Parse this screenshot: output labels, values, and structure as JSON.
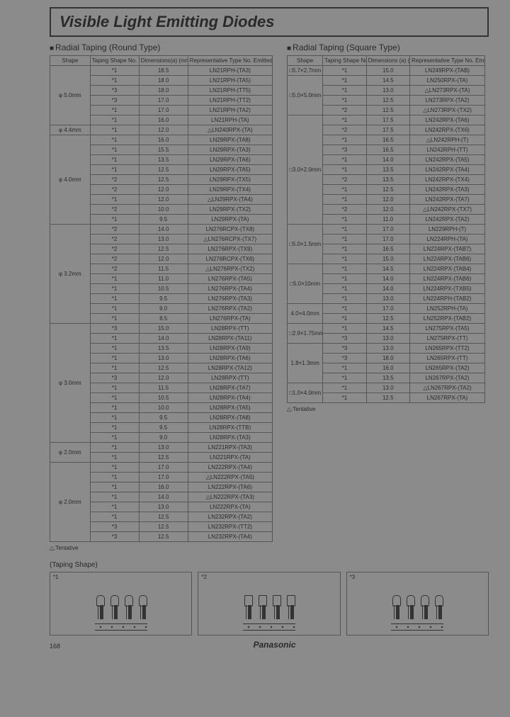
{
  "page_number": "168",
  "brand": "Panasonic",
  "title": "Visible Light Emitting Diodes",
  "tentative_note": "△:Tentative",
  "taping_shape_label": "(Taping Shape)",
  "diagram_labels": [
    "*1",
    "*2",
    "*3"
  ],
  "round": {
    "heading": "Radial Taping (Round Type)",
    "headers": [
      "Shape",
      "Taping Shape No.",
      "Dimensions(a) (mm)",
      "Representative Type No. Emitted Color (Red)"
    ],
    "groups": [
      {
        "shape": "φ 5.0mm",
        "rows": [
          {
            "ts": "*1",
            "dim": "18.5",
            "rep": "LN21RPH-(TA3)"
          },
          {
            "ts": "*1",
            "dim": "18.0",
            "rep": "LN21RPH-(TA5)"
          },
          {
            "ts": "*3",
            "dim": "18.0",
            "rep": "LN21RPH-(TT5)"
          },
          {
            "ts": "*3",
            "dim": "17.0",
            "rep": "LN21RPH-(TT2)"
          },
          {
            "ts": "*1",
            "dim": "17.0",
            "rep": "LN21RPH-(TA2)"
          },
          {
            "ts": "*1",
            "dim": "16.0",
            "rep": "LN21RPH-(TA)"
          }
        ]
      },
      {
        "shape": "φ 4.4mm",
        "rows": [
          {
            "ts": "*1",
            "dim": "12.0",
            "rep": "△LN240RPX-(TA)"
          }
        ]
      },
      {
        "shape": "φ 4.0mm",
        "rows": [
          {
            "ts": "*1",
            "dim": "16.0",
            "rep": "LN29RPX-(TA8)"
          },
          {
            "ts": "*1",
            "dim": "15.5",
            "rep": "LN29RPX-(TA3)"
          },
          {
            "ts": "*1",
            "dim": "13.5",
            "rep": "LN29RPX-(TA6)"
          },
          {
            "ts": "*1",
            "dim": "12.5",
            "rep": "LN29RPX-(TA5)"
          },
          {
            "ts": "*2",
            "dim": "12.5",
            "rep": "LN29RPX-(TX5)"
          },
          {
            "ts": "*2",
            "dim": "12.0",
            "rep": "LN29RPX-(TX4)"
          },
          {
            "ts": "*1",
            "dim": "12.0",
            "rep": "△LN29RPX-(TA4)"
          },
          {
            "ts": "*2",
            "dim": "10.0",
            "rep": "LN29RPX-(TX2)"
          },
          {
            "ts": "*1",
            "dim": "9.5",
            "rep": "LN29RPX-(TA)"
          }
        ]
      },
      {
        "shape": "φ 3.2mm",
        "rows": [
          {
            "ts": "*2",
            "dim": "14.0",
            "rep": "LN276RCPX-(TX8)"
          },
          {
            "ts": "*2",
            "dim": "13.0",
            "rep": "△LN276RCPX-(TX7)"
          },
          {
            "ts": "*2",
            "dim": "12.5",
            "rep": "LN276RPX-(TX9)"
          },
          {
            "ts": "*2",
            "dim": "12.0",
            "rep": "LN276RCPX-(TX6)"
          },
          {
            "ts": "*2",
            "dim": "11.5",
            "rep": "△LN276RPX-(TX2)"
          },
          {
            "ts": "*1",
            "dim": "11.0",
            "rep": "LN276RPX-(TA5)"
          },
          {
            "ts": "*1",
            "dim": "10.5",
            "rep": "LN276RPX-(TA4)"
          },
          {
            "ts": "*1",
            "dim": "9.5",
            "rep": "LN276RPX-(TA3)"
          },
          {
            "ts": "*1",
            "dim": "9.0",
            "rep": "LN276RPX-(TA2)"
          },
          {
            "ts": "*1",
            "dim": "8.5",
            "rep": "LN276RPX-(TA)"
          }
        ]
      },
      {
        "shape": "φ 3.0mm",
        "rows": [
          {
            "ts": "*3",
            "dim": "15.0",
            "rep": "LN28RPX-(TT)"
          },
          {
            "ts": "*1",
            "dim": "14.0",
            "rep": "LN28RPX-(TA11)"
          },
          {
            "ts": "*1",
            "dim": "13.5",
            "rep": "LN28RPX-(TA9)"
          },
          {
            "ts": "*1",
            "dim": "13.0",
            "rep": "LN28RPX-(TA6)"
          },
          {
            "ts": "*1",
            "dim": "12.5",
            "rep": "LN28RPX-(TA12)"
          },
          {
            "ts": "*3",
            "dim": "12.0",
            "rep": "LN28RPX-(TT)"
          },
          {
            "ts": "*1",
            "dim": "11.5",
            "rep": "LN28RPX-(TA7)"
          },
          {
            "ts": "*1",
            "dim": "10.5",
            "rep": "LN28RPX-(TA4)"
          },
          {
            "ts": "*1",
            "dim": "10.0",
            "rep": "LN28RPX-(TA5)"
          },
          {
            "ts": "*1",
            "dim": "9.5",
            "rep": "LN28RPX-(TA8)"
          },
          {
            "ts": "*1",
            "dim": "9.5",
            "rep": "LN28RPX-(TTB)"
          },
          {
            "ts": "*1",
            "dim": "9.0",
            "rep": "LN28RPX-(TA3)"
          }
        ]
      },
      {
        "shape": "φ 2.0mm",
        "rows": [
          {
            "ts": "*1",
            "dim": "13.0",
            "rep": "LN221RPX-(TA3)"
          },
          {
            "ts": "*1",
            "dim": "12.5",
            "rep": "LN221RPX-(TA)"
          }
        ]
      },
      {
        "shape": "φ 2.0mm",
        "rows": [
          {
            "ts": "*1",
            "dim": "17.0",
            "rep": "LN222RPX-(TA4)"
          },
          {
            "ts": "*1",
            "dim": "17.0",
            "rep": "△LN222RPX-(TA5)"
          },
          {
            "ts": "*1",
            "dim": "16.0",
            "rep": "LN222RPX-(TA6)"
          },
          {
            "ts": "*1",
            "dim": "14.0",
            "rep": "△LN222RPX-(TA3)"
          },
          {
            "ts": "*1",
            "dim": "13.0",
            "rep": "LN222RPX-(TA)"
          },
          {
            "ts": "*1",
            "dim": "12.5",
            "rep": "LN232RPX-(TA2)"
          },
          {
            "ts": "*3",
            "dim": "12.5",
            "rep": "LN232RPX-(TT2)"
          },
          {
            "ts": "*3",
            "dim": "12.5",
            "rep": "LN232RPX-(TA4)"
          }
        ]
      }
    ]
  },
  "square": {
    "heading": "Radial Taping (Square Type)",
    "headers": [
      "Shape",
      "Taping Shape No.",
      "Dimensions (a) (mm)",
      "Representative Type No. Emitted Color (Red)"
    ],
    "groups": [
      {
        "shape": "□5.7×2.7mm",
        "rows": [
          {
            "ts": "*1",
            "dim": "15.0",
            "rep": "LN249RPX-(TAB)"
          }
        ]
      },
      {
        "shape": "□5.0×5.0mm",
        "rows": [
          {
            "ts": "*1",
            "dim": "14.5",
            "rep": "LN250RPX-(TA)"
          },
          {
            "ts": "*1",
            "dim": "13.0",
            "rep": "△LN273RPX-(TA)"
          },
          {
            "ts": "*1",
            "dim": "12.5",
            "rep": "LN273RPX-(TA2)"
          },
          {
            "ts": "*2",
            "dim": "12.5",
            "rep": "△LN273RPX-(TX2)"
          }
        ]
      },
      {
        "shape": "□3.0×2.0mm",
        "rows": [
          {
            "ts": "*1",
            "dim": "17.5",
            "rep": "LN242RPX-(TA6)"
          },
          {
            "ts": "*2",
            "dim": "17.5",
            "rep": "LN242RPX-(TX6)"
          },
          {
            "ts": "*1",
            "dim": "16.5",
            "rep": "△LN242RPH-(T)"
          },
          {
            "ts": "*3",
            "dim": "16.5",
            "rep": "LN242RPH-(TT)"
          },
          {
            "ts": "*1",
            "dim": "14.0",
            "rep": "LN242RPX-(TA5)"
          },
          {
            "ts": "*1",
            "dim": "13.5",
            "rep": "LN242RPX-(TA4)"
          },
          {
            "ts": "*2",
            "dim": "13.5",
            "rep": "LN242RPX-(TX4)"
          },
          {
            "ts": "*1",
            "dim": "12.5",
            "rep": "LN242RPX-(TA3)"
          },
          {
            "ts": "*1",
            "dim": "12.0",
            "rep": "LN242RPX-(TA7)"
          },
          {
            "ts": "*2",
            "dim": "12.0",
            "rep": "△LN242RPX-(TX7)"
          },
          {
            "ts": "*1",
            "dim": "11.0",
            "rep": "LN242RPX-(TA2)"
          }
        ]
      },
      {
        "shape": "□5.0×1.5mm",
        "rows": [
          {
            "ts": "*1",
            "dim": "17.0",
            "rep": "LN229RPH-(T)"
          },
          {
            "ts": "*1",
            "dim": "17.0",
            "rep": "LN224RPH-(TA)"
          },
          {
            "ts": "*1",
            "dim": "16.5",
            "rep": "LN224RPX-(TAB7)"
          },
          {
            "ts": "*1",
            "dim": "15.0",
            "rep": "LN224RPX-(TAB6)"
          }
        ]
      },
      {
        "shape": "□5.0×10mm",
        "rows": [
          {
            "ts": "*1",
            "dim": "14.5",
            "rep": "LN224RPX-(TAB4)"
          },
          {
            "ts": "*1",
            "dim": "14.0",
            "rep": "LN224RPX-(TAB6)"
          },
          {
            "ts": "*1",
            "dim": "14.0",
            "rep": "LN224RPX-(TXB5)"
          },
          {
            "ts": "*1",
            "dim": "13.0",
            "rep": "LN224RPH-(TAB2)"
          }
        ]
      },
      {
        "shape": "4.0×4.0mm",
        "rows": [
          {
            "ts": "*1",
            "dim": "17.0",
            "rep": "LN252RPH-(TA)"
          },
          {
            "ts": "*1",
            "dim": "12.5",
            "rep": "LN252RPX-(TAB2)"
          }
        ]
      },
      {
        "shape": "□2.9×1.75mm",
        "rows": [
          {
            "ts": "*1",
            "dim": "14.5",
            "rep": "LN275RPX-(TA5)"
          },
          {
            "ts": "*3",
            "dim": "13.0",
            "rep": "LN275RPX-(TT)"
          }
        ]
      },
      {
        "shape": "1.8×1.3mm",
        "rows": [
          {
            "ts": "*3",
            "dim": "13.0",
            "rep": "LN265RPX-(TT2)"
          },
          {
            "ts": "*3",
            "dim": "18.0",
            "rep": "LN265RPX-(TT)"
          },
          {
            "ts": "*1",
            "dim": "16.0",
            "rep": "LN265RPX-(TA2)"
          },
          {
            "ts": "*1",
            "dim": "13.5",
            "rep": "LN267RPX-(TA2)"
          }
        ]
      },
      {
        "shape": "□1.0×4.0mm",
        "rows": [
          {
            "ts": "*1",
            "dim": "13.0",
            "rep": "△LN267RPX-(TA2)"
          },
          {
            "ts": "*1",
            "dim": "12.5",
            "rep": "LN267RPX-(TA)"
          }
        ]
      }
    ]
  }
}
